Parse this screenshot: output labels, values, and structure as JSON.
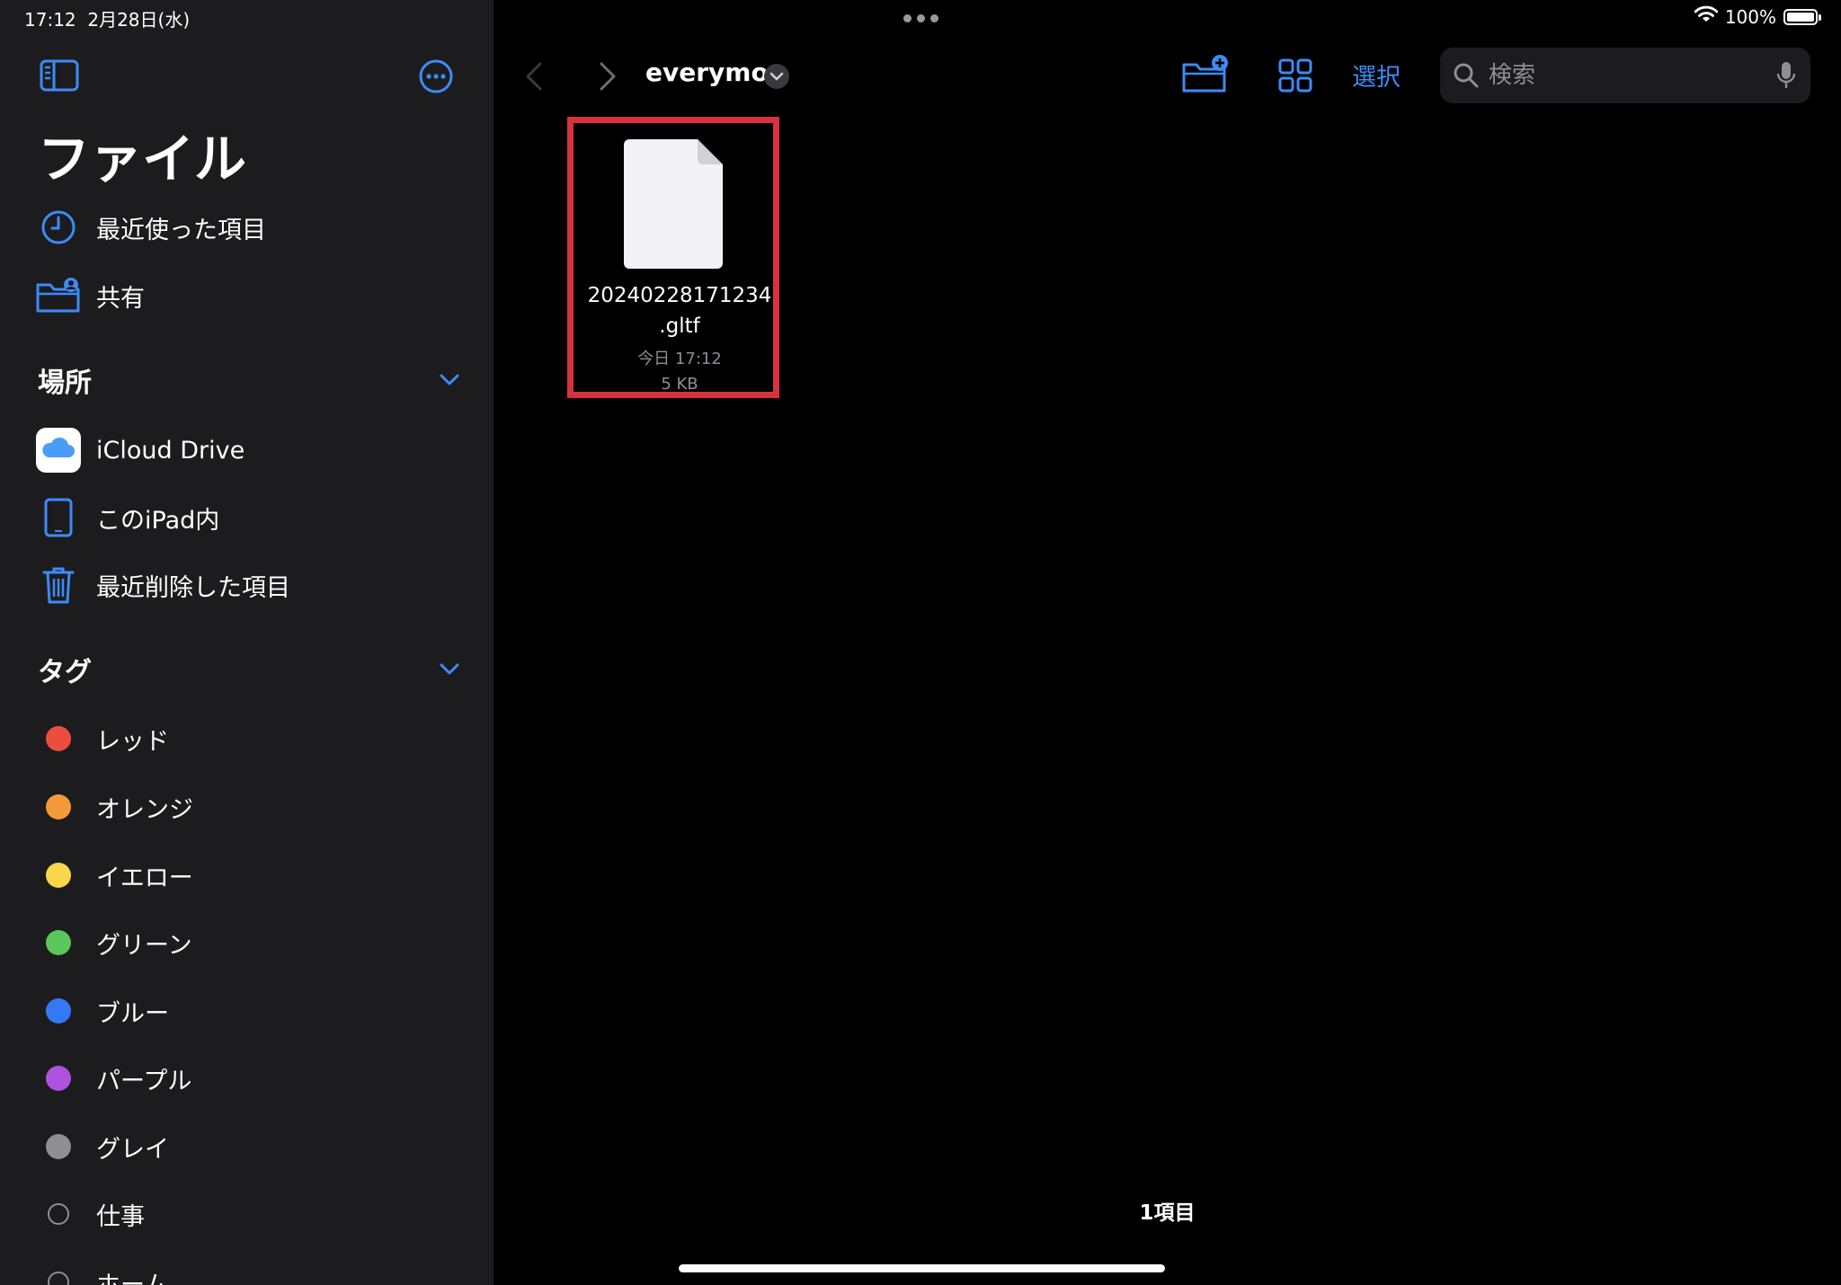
{
  "status_bar": {
    "time": "17:12",
    "date": "2月28日(水)",
    "battery_percent": "100%",
    "battery_level": 1.0
  },
  "sidebar": {
    "title": "ファイル",
    "favorites": [
      {
        "label": "最近使った項目",
        "icon": "clock-icon"
      },
      {
        "label": "共有",
        "icon": "shared-folder-icon"
      }
    ],
    "locations_header": "場所",
    "locations": [
      {
        "label": "iCloud Drive",
        "icon": "icloud-icon"
      },
      {
        "label": "このiPad内",
        "icon": "ipad-icon"
      },
      {
        "label": "最近削除した項目",
        "icon": "trash-icon"
      }
    ],
    "tags_header": "タグ",
    "tags": [
      {
        "label": "レッド",
        "color": "#eb4e3d"
      },
      {
        "label": "オレンジ",
        "color": "#f19a37"
      },
      {
        "label": "イエロー",
        "color": "#f8d84a"
      },
      {
        "label": "グリーン",
        "color": "#5bc65a"
      },
      {
        "label": "ブルー",
        "color": "#3478f6"
      },
      {
        "label": "パープル",
        "color": "#af52de"
      },
      {
        "label": "グレイ",
        "color": "#8e8e93"
      },
      {
        "label": "仕事",
        "color": ""
      },
      {
        "label": "ホーム",
        "color": ""
      }
    ]
  },
  "toolbar": {
    "folder_name": "everymo",
    "select_label": "選択",
    "search_placeholder": "検索"
  },
  "files": [
    {
      "name_line1": "20240228171234",
      "name_line2": ".gltf",
      "date": "今日 17:12",
      "size": "5 KB",
      "highlighted": true
    }
  ],
  "footer": {
    "item_count": "1項目"
  },
  "colors": {
    "accent": "#3d8bf7",
    "highlight_border": "#d7333e",
    "sidebar_bg": "#1c1c1e",
    "main_bg": "#000000"
  }
}
